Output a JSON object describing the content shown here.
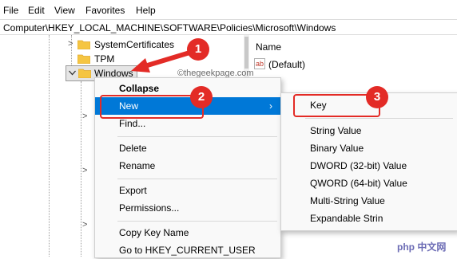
{
  "menubar": {
    "items": [
      "File",
      "Edit",
      "View",
      "Favorites",
      "Help"
    ]
  },
  "address": {
    "path": "Computer\\HKEY_LOCAL_MACHINE\\SOFTWARE\\Policies\\Microsoft\\Windows"
  },
  "tree": {
    "items": [
      {
        "label": "SystemCertificates",
        "chevron": ">"
      },
      {
        "label": "TPM",
        "chevron": ""
      },
      {
        "label": "Windows",
        "chevron": "v"
      }
    ],
    "collapsed_chevrons": [
      ">",
      ">",
      ">"
    ]
  },
  "right_pane": {
    "header": "Name",
    "rows": [
      {
        "icon": "ab",
        "name": "(Default)"
      }
    ]
  },
  "context_menu": {
    "collapse": "Collapse",
    "new": "New",
    "new_arrow": "›",
    "find": "Find...",
    "delete": "Delete",
    "rename": "Rename",
    "export": "Export",
    "permissions": "Permissions...",
    "copy_key_name": "Copy Key Name",
    "goto": "Go to HKEY_CURRENT_USER"
  },
  "submenu": {
    "items": [
      "Key",
      "String Value",
      "Binary Value",
      "DWORD (32-bit) Value",
      "QWORD (64-bit) Value",
      "Multi-String Value",
      "Expandable Strin"
    ]
  },
  "annotations": {
    "badges": [
      "1",
      "2",
      "3"
    ],
    "color": "#e32b26"
  },
  "watermarks": {
    "site": "©thegeekpage.com",
    "php": "php 中文网"
  },
  "colors": {
    "highlight": "#0078d7",
    "folder": "#f5c542",
    "folder_dark": "#e0a82e"
  }
}
